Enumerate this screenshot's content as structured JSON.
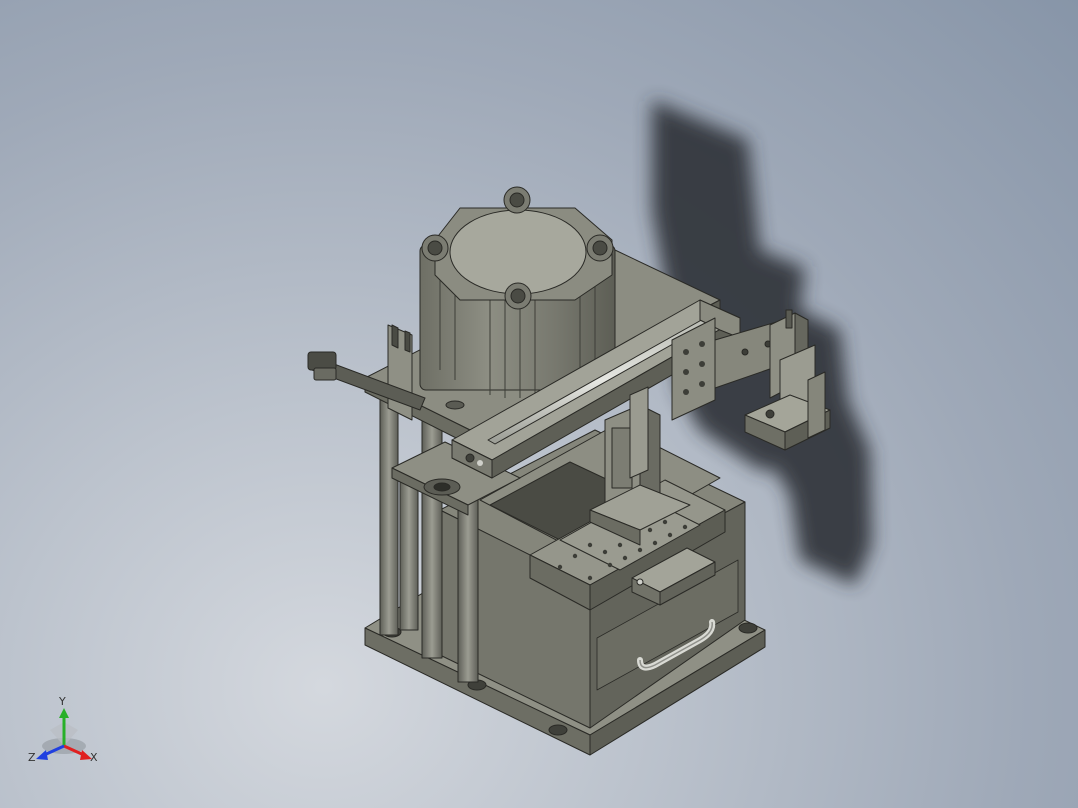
{
  "viewport": {
    "view": "isometric",
    "background_top": "#8795a8",
    "background_bottom": "#d4d8de",
    "model_color": "#8a8b80",
    "shadow_color": "#2f3338"
  },
  "triad": {
    "x_label": "X",
    "y_label": "Y",
    "z_label": "Z",
    "x_color": "#e02020",
    "y_color": "#28b028",
    "z_color": "#2040e0"
  }
}
